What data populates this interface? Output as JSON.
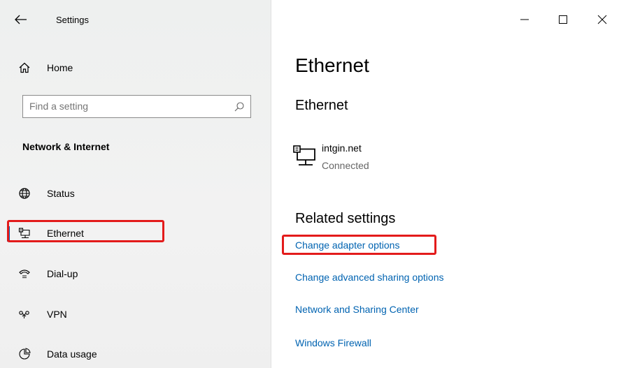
{
  "window": {
    "app_title": "Settings",
    "controls": [
      "minimize",
      "maximize",
      "close"
    ]
  },
  "sidebar": {
    "home_label": "Home",
    "search_placeholder": "Find a setting",
    "section_heading": "Network & Internet",
    "items": [
      {
        "label": "Status",
        "icon": "globe-icon"
      },
      {
        "label": "Ethernet",
        "icon": "ethernet-icon",
        "selected": true
      },
      {
        "label": "Dial-up",
        "icon": "phone-icon"
      },
      {
        "label": "VPN",
        "icon": "vpn-icon"
      },
      {
        "label": "Data usage",
        "icon": "data-usage-icon"
      }
    ]
  },
  "main": {
    "page_title": "Ethernet",
    "sub_title": "Ethernet",
    "device": {
      "name": "intgin.net",
      "status": "Connected",
      "icon": "ethernet-icon"
    },
    "related_heading": "Related settings",
    "links": [
      "Change adapter options",
      "Change advanced sharing options",
      "Network and Sharing Center",
      "Windows Firewall"
    ]
  },
  "colors": {
    "accent": "#0063b1",
    "highlight": "#e31b1b",
    "sidebar_bg": "#f2f2f2"
  }
}
